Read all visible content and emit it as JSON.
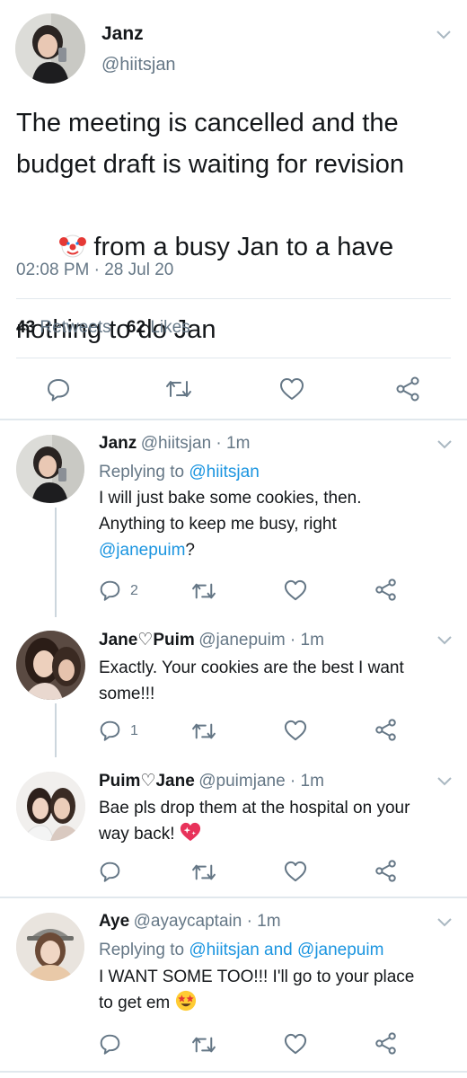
{
  "main_tweet": {
    "author_name": "Janz",
    "author_handle": "@hiitsjan",
    "text_line1": "The meeting is cancelled and the",
    "text_line2": "budget draft is waiting for revision",
    "text_line3": " from a busy Jan to a have",
    "text_line4": "nothing to do Jan",
    "emoji": "clown-face",
    "timestamp": "02:08 PM · 28 Jul 20",
    "retweets_count": "43",
    "retweets_label": "Retweets",
    "likes_count": "62",
    "likes_label": "Likes"
  },
  "replies": [
    {
      "name": "Janz",
      "handle": "@hiitsjan · 1m",
      "replying_prefix": "Replying to ",
      "replying_to": "@hiitsjan",
      "line1": "I will just bake some cookies, then.",
      "line2": "Anything to keep me busy, right",
      "mention": "@janepuim",
      "after_mention": "?",
      "reply_count": "2"
    },
    {
      "name": "Jane♡Puim",
      "handle": "@janepuim · 1m",
      "line1": "Exactly. Your cookies are the best I want",
      "line2": "some!!!",
      "reply_count": "1"
    },
    {
      "name": "Puim♡Jane",
      "handle": "@puimjane · 1m",
      "line1": "Bae pls drop them at the hospital on your",
      "line2": "way back!",
      "emoji": "sparkling-heart"
    },
    {
      "name": "Aye",
      "handle": "@ayaycaptain · 1m",
      "replying_prefix": "Replying to ",
      "replying_to": "@hiitsjan and @janepuim",
      "line1": "I WANT SOME TOO!!! I'll go to your place",
      "line2": "to get em",
      "emoji": "star-struck"
    }
  ],
  "icons": [
    "reply-icon",
    "retweet-icon",
    "like-icon",
    "share-icon",
    "chevron-down-icon"
  ],
  "colors": {
    "text": "#14171a",
    "secondary": "#657786",
    "link": "#1b95e0",
    "divider": "#e1e8ed"
  }
}
